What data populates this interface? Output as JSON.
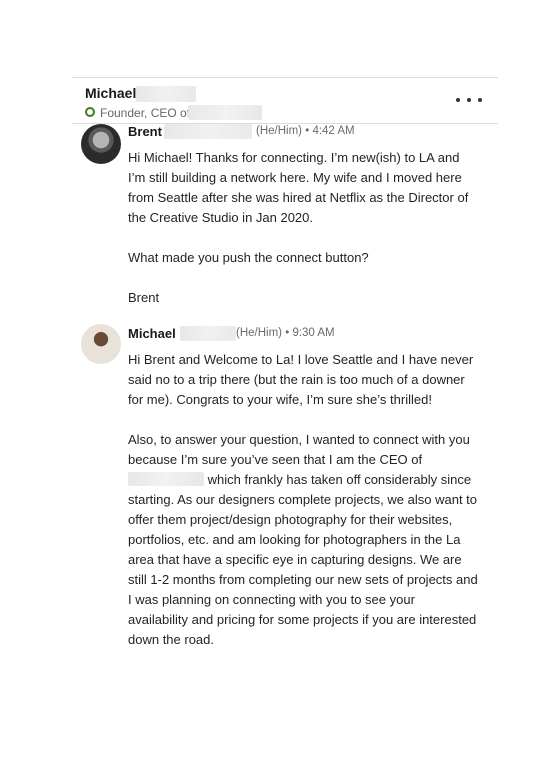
{
  "conversation": {
    "contact_name": "Michael",
    "contact_headline": "Founder, CEO of",
    "more_label": "•••"
  },
  "messages": [
    {
      "sender": "Brent",
      "pronouns": "(He/Him)",
      "separator": "•",
      "time": "4:42 AM",
      "paragraphs": [
        "Hi Michael! Thanks for connecting. I’m new(ish) to LA and I’m still building a network here. My wife and I moved here from Seattle after she was hired at Netflix as the Director of the Creative Studio in Jan 2020.",
        "What made you push the connect button?",
        "Brent"
      ]
    },
    {
      "sender": "Michael",
      "pronouns": "(He/Him)",
      "separator": "•",
      "time": "9:30 AM",
      "paragraphs": [
        "Hi Brent and Welcome to La! I love Seattle and I have never said no to a trip there (but the rain is too much of a downer for me). Congrats to your wife, I’m sure she’s thrilled!",
        "Also, to answer your question, I wanted to connect with you because I’m sure you’ve seen that I am the CEO of"
      ],
      "paragraph_2_continued": "which frankly has taken off considerably since starting. As our designers complete projects, we also want to offer them project/design photography for their websites, portfolios, etc. and am looking for photographers in the La area that have a specific eye in capturing designs. We are still 1-2 months from completing our new sets of projects and I was planning on connecting with you to see your availability and pricing for some projects if you are interested down the road."
    }
  ],
  "colors": {
    "status_ring": "#3f7a2a",
    "divider": "#dcdcdc",
    "text": "#242424",
    "meta_text": "#6b6b6b"
  },
  "icons": {
    "status": "online-ring-icon",
    "more": "more-horizontal-icon"
  }
}
